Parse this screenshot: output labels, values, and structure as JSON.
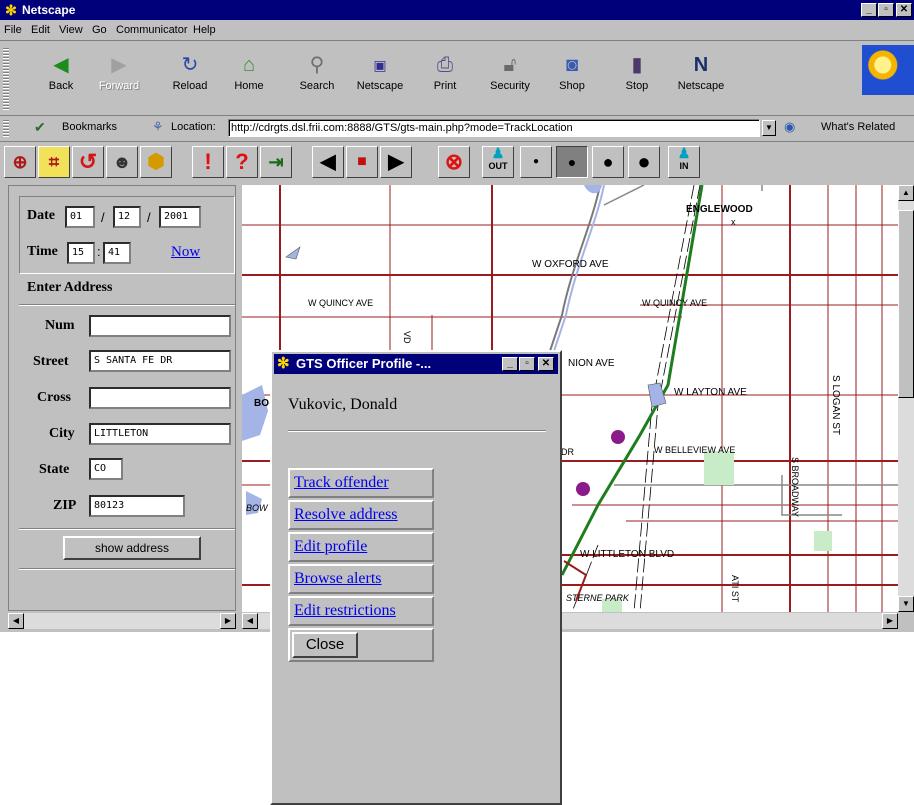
{
  "app": {
    "title": "Netscape"
  },
  "menu": [
    "File",
    "Edit",
    "View",
    "Go",
    "Communicator",
    "Help"
  ],
  "navigation_toolbar": [
    {
      "label": "Back",
      "icon": "back-arrow-icon",
      "enabled": true
    },
    {
      "label": "Forward",
      "icon": "forward-arrow-icon",
      "enabled": false
    },
    {
      "label": "Reload",
      "icon": "reload-icon",
      "enabled": true
    },
    {
      "label": "Home",
      "icon": "home-icon",
      "enabled": true
    },
    {
      "label": "Search",
      "icon": "search-icon",
      "enabled": true
    },
    {
      "label": "Netscape",
      "icon": "my-netscape-icon",
      "enabled": true
    },
    {
      "label": "Print",
      "icon": "print-icon",
      "enabled": true
    },
    {
      "label": "Security",
      "icon": "lock-icon",
      "enabled": true
    },
    {
      "label": "Shop",
      "icon": "shop-icon",
      "enabled": true
    },
    {
      "label": "Stop",
      "icon": "stop-icon",
      "enabled": true
    },
    {
      "label": "Netscape",
      "icon": "netscape-n-icon",
      "enabled": true
    }
  ],
  "location_bar": {
    "bookmarks_label": "Bookmarks",
    "location_label": "Location:",
    "url": "http://cdrgts.dsl.frii.com:8888/GTS/gts-main.php?mode=TrackLocation",
    "whats_related": "What's Related"
  },
  "gts_toolbar": {
    "icons": [
      "target-icon",
      "map-grid-icon",
      "circle-arrow-icon",
      "officer-head-icon",
      "badge-icon",
      "exclamation-icon",
      "question-icon",
      "exit-door-icon",
      "rewind-icon",
      "stop-square-icon",
      "play-icon",
      "cancel-circle-icon",
      "out-person-icon",
      "dot-small-icon",
      "dot-medium-icon",
      "dot-large-icon",
      "dot-xlarge-icon",
      "in-person-icon"
    ],
    "out_label": "OUT",
    "in_label": "IN",
    "selected_index": 14
  },
  "left_panel": {
    "date_label": "Date",
    "date_month": "01",
    "date_day": "12",
    "date_year": "2001",
    "date_sep": "/",
    "time_label": "Time",
    "time_hour": "15",
    "time_minute": "41",
    "time_sep": ":",
    "now_link": "Now",
    "enter_address_heading": "Enter Address",
    "num_label": "Num",
    "num_value": "",
    "street_label": "Street",
    "street_value": "S SANTA FE DR",
    "cross_label": "Cross",
    "cross_value": "",
    "city_label": "City",
    "city_value": "LITTLETON",
    "state_label": "State",
    "state_value": "CO",
    "zip_label": "ZIP",
    "zip_value": "80123",
    "show_address_button": "show address"
  },
  "map": {
    "labels": {
      "englewood": "ENGLEWOOD",
      "oxford": "W OXFORD AVE",
      "quincy_left": "W QUINCY AVE",
      "quincy_right": "W QUINCY AVE",
      "layton_partial": "NION AVE",
      "layton": "W LAYTON AVE",
      "bellview": "W BELLEVIEW AVE",
      "logan": "S LOGAN ST",
      "broadway": "S BROADWAY",
      "littleton_blvd": "W LITTLETON BLVD",
      "sterne_park": "STERNE PARK",
      "ati_st": "ATI ST",
      "dr_fragment": "DR",
      "vd_fragment": "VD",
      "bo_fragment": "BO",
      "bow_fragment": "BOW",
      "x_mark": "x"
    },
    "colors": {
      "major_road": "#9b1c1c",
      "rail": "#1e7d1e",
      "water": "#a4b4e6",
      "park": "#c8ecc8",
      "marker": "#8b1a8b"
    }
  },
  "popup": {
    "title": "GTS Officer Profile -...",
    "officer_name": "Vukovic, Donald",
    "links": [
      "Track offender",
      "Resolve address",
      "Edit profile",
      "Browse alerts",
      "Edit restrictions"
    ],
    "close_button": "Close"
  }
}
